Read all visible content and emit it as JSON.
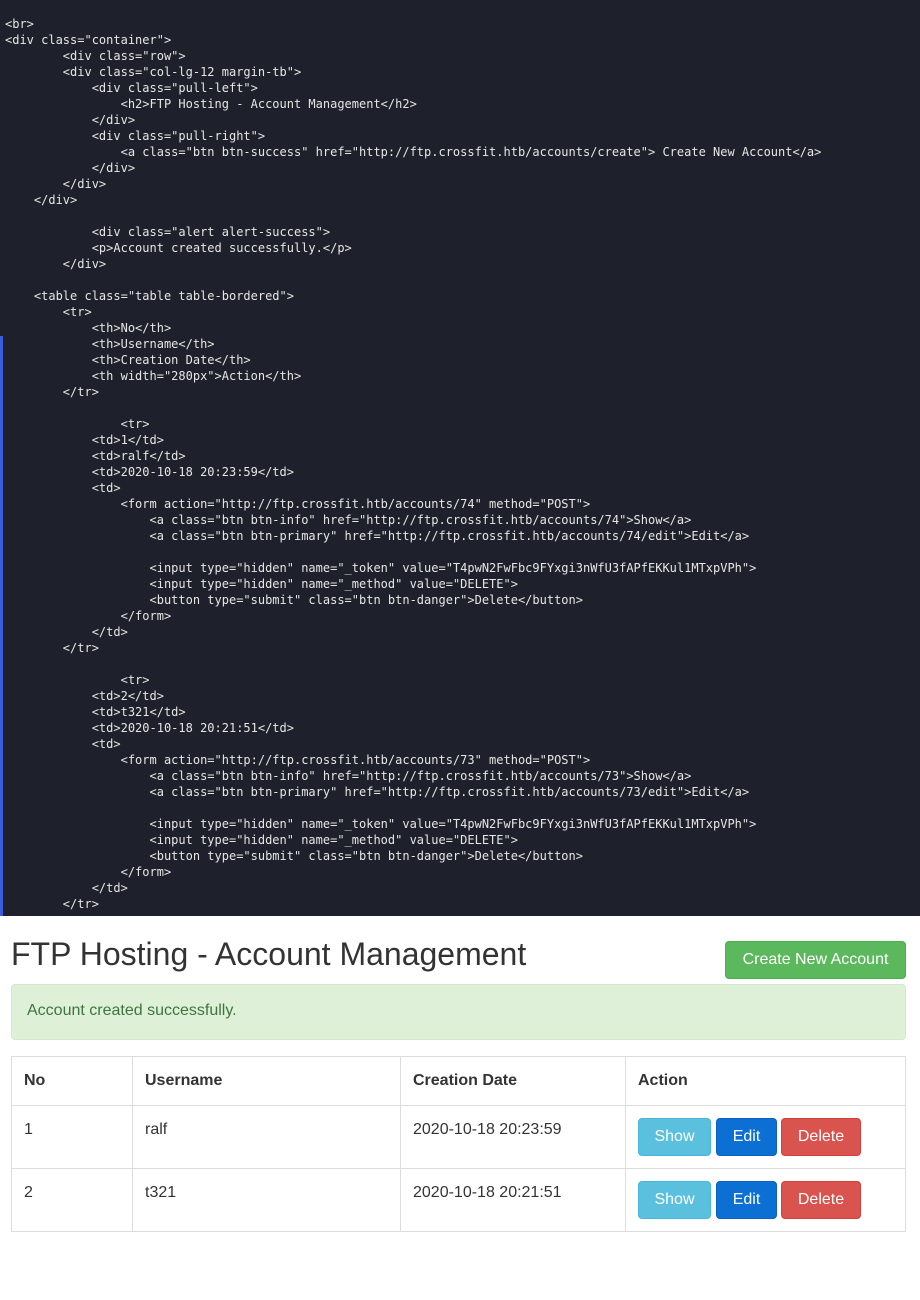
{
  "code_view": {
    "lines": [
      "<br>",
      "<div class=\"container\">",
      "        <div class=\"row\">",
      "        <div class=\"col-lg-12 margin-tb\">",
      "            <div class=\"pull-left\">",
      "                <h2>FTP Hosting - Account Management</h2>",
      "            </div>",
      "            <div class=\"pull-right\">",
      "                <a class=\"btn btn-success\" href=\"http://ftp.crossfit.htb/accounts/create\"> Create New Account</a>",
      "            </div>",
      "        </div>",
      "    </div>",
      "",
      "            <div class=\"alert alert-success\">",
      "            <p>Account created successfully.</p>",
      "        </div>",
      "",
      "    <table class=\"table table-bordered\">",
      "        <tr>",
      "            <th>No</th>",
      "            <th>Username</th>",
      "            <th>Creation Date</th>",
      "            <th width=\"280px\">Action</th>",
      "        </tr>",
      "",
      "                <tr>",
      "            <td>1</td>",
      "            <td>ralf</td>",
      "            <td>2020-10-18 20:23:59</td>",
      "            <td>",
      "                <form action=\"http://ftp.crossfit.htb/accounts/74\" method=\"POST\">",
      "                    <a class=\"btn btn-info\" href=\"http://ftp.crossfit.htb/accounts/74\">Show</a>",
      "                    <a class=\"btn btn-primary\" href=\"http://ftp.crossfit.htb/accounts/74/edit\">Edit</a>",
      "",
      "                    <input type=\"hidden\" name=\"_token\" value=\"T4pwN2FwFbc9FYxgi3nWfU3fAPfEKKul1MTxpVPh\">",
      "                    <input type=\"hidden\" name=\"_method\" value=\"DELETE\">",
      "                    <button type=\"submit\" class=\"btn btn-danger\">Delete</button>",
      "                </form>",
      "            </td>",
      "        </tr>",
      "",
      "                <tr>",
      "            <td>2</td>",
      "            <td>t321</td>",
      "            <td>2020-10-18 20:21:51</td>",
      "            <td>",
      "                <form action=\"http://ftp.crossfit.htb/accounts/73\" method=\"POST\">",
      "                    <a class=\"btn btn-info\" href=\"http://ftp.crossfit.htb/accounts/73\">Show</a>",
      "                    <a class=\"btn btn-primary\" href=\"http://ftp.crossfit.htb/accounts/73/edit\">Edit</a>",
      "",
      "                    <input type=\"hidden\" name=\"_token\" value=\"T4pwN2FwFbc9FYxgi3nWfU3fAPfEKKul1MTxpVPh\">",
      "                    <input type=\"hidden\" name=\"_method\" value=\"DELETE\">",
      "                    <button type=\"submit\" class=\"btn btn-danger\">Delete</button>",
      "                </form>",
      "            </td>",
      "        </tr>"
    ]
  },
  "page": {
    "title": "FTP Hosting - Account Management",
    "create_button_label": "Create New Account",
    "alert_text": "Account created successfully.",
    "table": {
      "headers": [
        "No",
        "Username",
        "Creation Date",
        "Action"
      ],
      "rows": [
        {
          "no": "1",
          "username": "ralf",
          "created": "2020-10-18 20:23:59"
        },
        {
          "no": "2",
          "username": "t321",
          "created": "2020-10-18 20:21:51"
        }
      ],
      "action_labels": {
        "show": "Show",
        "edit": "Edit",
        "delete": "Delete"
      }
    }
  },
  "colors": {
    "code_background": "#1e212b",
    "success": "#5cb85c",
    "info": "#5bc0de",
    "primary": "#0c6fd3",
    "danger": "#d9534f",
    "alert_background": "#dff0d8",
    "alert_text": "#3c763d"
  }
}
